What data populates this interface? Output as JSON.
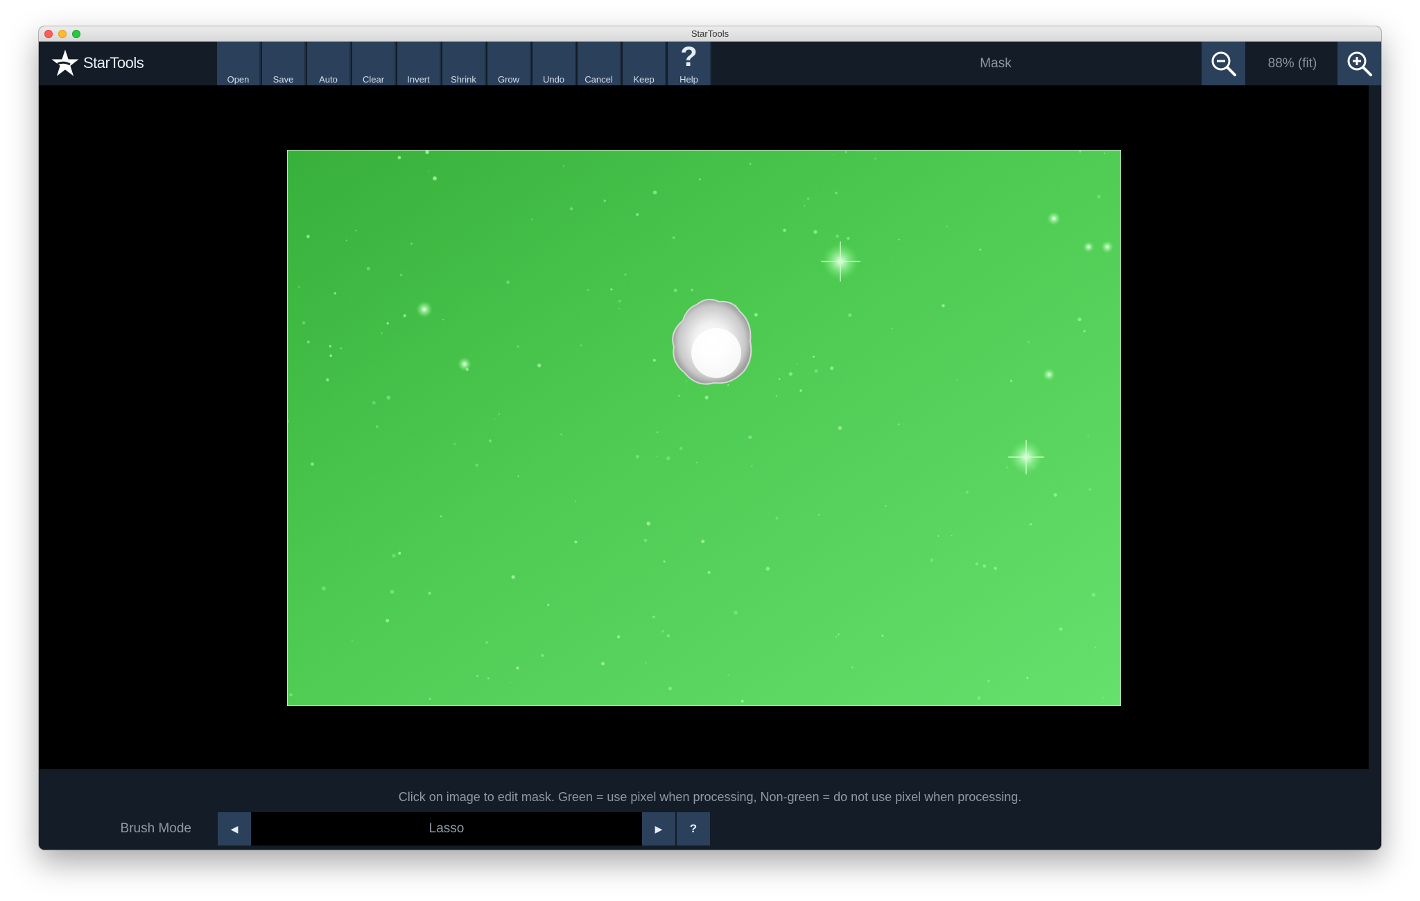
{
  "window": {
    "title": "StarTools"
  },
  "app": {
    "logo_text": "StarTools"
  },
  "toolbar": {
    "buttons": [
      {
        "label": "Open"
      },
      {
        "label": "Save"
      },
      {
        "label": "Auto"
      },
      {
        "label": "Clear"
      },
      {
        "label": "Invert"
      },
      {
        "label": "Shrink"
      },
      {
        "label": "Grow"
      },
      {
        "label": "Undo"
      },
      {
        "label": "Cancel"
      },
      {
        "label": "Keep"
      },
      {
        "label": "Help",
        "icon": "question-icon"
      }
    ],
    "module_title": "Mask",
    "zoom_out_icon": "zoom-out-icon",
    "zoom_in_icon": "zoom-in-icon",
    "zoom_level": "88% (fit)"
  },
  "mask": {
    "selected_color": "#4cd24c",
    "unselected_color": "#ffffff"
  },
  "footer": {
    "hint": "Click on image to edit mask. Green = use pixel when processing, Non-green = do not use pixel when processing.",
    "brush_mode_label": "Brush Mode",
    "brush_mode_value": "Lasso",
    "help_label": "?"
  },
  "colors": {
    "toolbar_bg": "#131c27",
    "button_bg": "#2b405a",
    "canvas_bg": "#000000"
  }
}
